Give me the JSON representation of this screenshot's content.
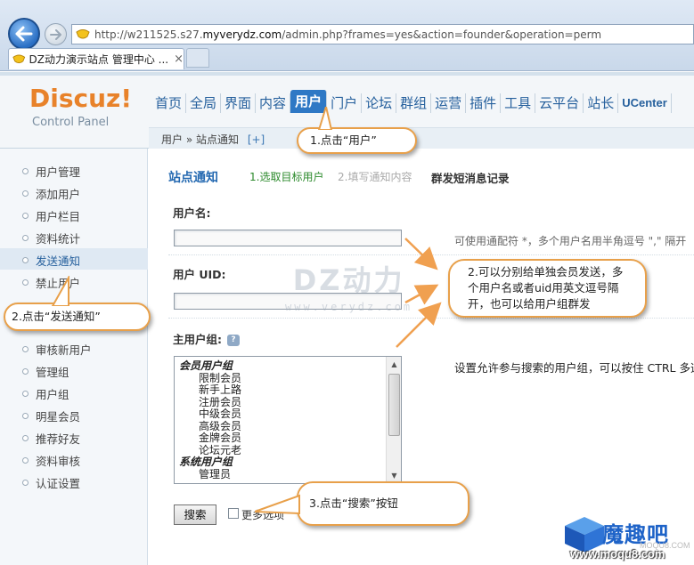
{
  "browser": {
    "url_prefix": "http://w211525.s27.",
    "url_domain": "myverydz.com",
    "url_path": "/admin.php?frames=yes&action=founder&operation=perm",
    "tab_title": "DZ动力演示站点 管理中心 ...",
    "tab_close": "×"
  },
  "logo": {
    "main": "Discuz!",
    "sub": "Control Panel"
  },
  "topnav": {
    "items": [
      "首页",
      "全局",
      "界面",
      "内容",
      "用户",
      "门户",
      "论坛",
      "群组",
      "运营",
      "插件",
      "工具",
      "云平台",
      "站长",
      "UCenter"
    ],
    "active_index": 4
  },
  "breadcrumb": {
    "path": "用户 » 站点通知",
    "plus": "[+]"
  },
  "sidebar": {
    "items": [
      "用户管理",
      "添加用户",
      "用户栏目",
      "资料统计",
      "发送通知",
      "禁止用户",
      "审核新用户",
      "管理组",
      "用户组",
      "明星会员",
      "推荐好友",
      "资料审核",
      "认证设置"
    ],
    "active_index": 4
  },
  "main": {
    "title": "站点通知",
    "step1": "1.选取目标用户",
    "step2": "2.填写通知内容",
    "step3": "群发短消息记录",
    "username_label": "用户名:",
    "username_tip": "可使用通配符 *，多个用户名用半角逗号 \",\" 隔开",
    "uid_label": "用户 UID:",
    "group_label": "主用户组:",
    "group_tip": "设置允许参与搜索的用户组，可以按住 CTRL 多选",
    "groups": [
      {
        "name": "会员用户组",
        "type": "group"
      },
      {
        "name": "限制会员",
        "type": "item"
      },
      {
        "name": "新手上路",
        "type": "item"
      },
      {
        "name": "注册会员",
        "type": "item"
      },
      {
        "name": "中级会员",
        "type": "item"
      },
      {
        "name": "高级会员",
        "type": "item"
      },
      {
        "name": "金牌会员",
        "type": "item"
      },
      {
        "name": "论坛元老",
        "type": "item"
      },
      {
        "name": "系统用户组",
        "type": "group"
      },
      {
        "name": "管理员",
        "type": "item"
      }
    ],
    "search_button": "搜索",
    "more_options": "更多选项"
  },
  "callouts": {
    "c1": "1.点击“用户”",
    "c2": "2.点击“发送通知”",
    "c3": "2.可以分别给单独会员发送，多\n个用户名或者uid用英文逗号隔\n开，也可以给用户组群发",
    "c4": "3.点击“搜索”按钮"
  },
  "watermarks": {
    "dz_main": "DZ动力",
    "dz_sub": "www.verydz.com",
    "moqu_name": "魔趣吧",
    "moqu_domain": "www.moqu8.com",
    "moqu_domain_wm": "MOQU8.COM"
  },
  "colors": {
    "accent": "#2e78c5",
    "logo_orange": "#e8822a",
    "callout_border": "#e8a04a",
    "arrow": "#f0a050"
  }
}
